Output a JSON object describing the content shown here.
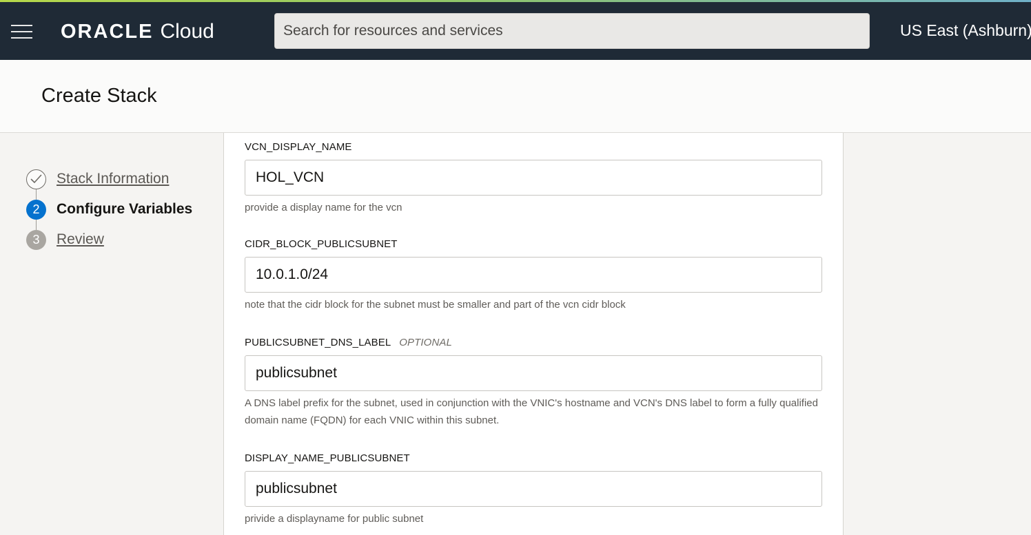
{
  "header": {
    "menu_icon": "hamburger-menu-icon",
    "logo_brand": "ORACLE",
    "logo_product": "Cloud",
    "search_placeholder": "Search for resources and services",
    "region": "US East (Ashburn)",
    "colors": {
      "topbar": "#1f2a36",
      "accent_active": "#0572ce"
    }
  },
  "page": {
    "title": "Create Stack"
  },
  "wizard": {
    "steps": [
      {
        "indicator": "check-icon",
        "label": "Stack Information",
        "state": "completed"
      },
      {
        "indicator": "2",
        "label": "Configure Variables",
        "state": "active"
      },
      {
        "indicator": "3",
        "label": "Review",
        "state": "pending"
      }
    ]
  },
  "form": {
    "fields": [
      {
        "label": "VCN_DISPLAY_NAME",
        "value": "HOL_VCN",
        "help": "provide a display name for the vcn"
      },
      {
        "label": "CIDR_BLOCK_PUBLICSUBNET",
        "value": "10.0.1.0/24",
        "help": "note that the cidr block for the subnet must be smaller and part of the vcn cidr block"
      },
      {
        "label": "PUBLICSUBNET_DNS_LABEL",
        "optional": "OPTIONAL",
        "value": "publicsubnet",
        "help": "A DNS label prefix for the subnet, used in conjunction with the VNIC's hostname and VCN's DNS label to form a fully qualified domain name (FQDN) for each VNIC within this subnet."
      },
      {
        "label": "DISPLAY_NAME_PUBLICSUBNET",
        "value": "publicsubnet",
        "help": "privide a displayname for public subnet"
      }
    ]
  }
}
